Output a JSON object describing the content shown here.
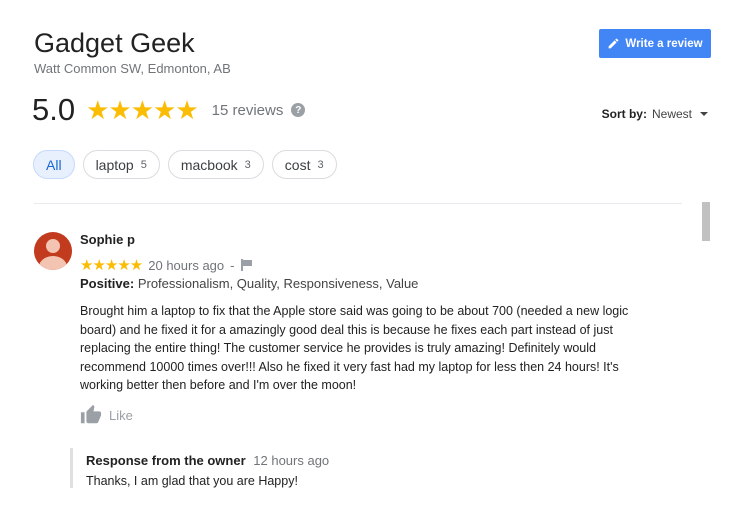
{
  "business": {
    "name": "Gadget Geek",
    "address": "Watt Common SW, Edmonton, AB",
    "write_review_label": "Write a review",
    "rating": "5.0",
    "stars": "★★★★★",
    "reviews_count": "15 reviews",
    "help_icon": "?"
  },
  "sort": {
    "label": "Sort by:",
    "value": "Newest"
  },
  "filters": [
    {
      "label": "All",
      "count": ""
    },
    {
      "label": "laptop",
      "count": "5"
    },
    {
      "label": "macbook",
      "count": "3"
    },
    {
      "label": "cost",
      "count": "3"
    }
  ],
  "review": {
    "author": "Sophie p",
    "stars": "★★★★★",
    "time": "20 hours ago",
    "separator": "-",
    "positive_label": "Positive:",
    "positive_values": "Professionalism, Quality, Responsiveness, Value",
    "text": "Brought him a laptop to fix that the Apple store said was going to be about 700 (needed a new logic board) and he fixed it for a amazingly good deal this is because he fixes each part instead of just replacing the entire thing! The customer service he provides is truly amazing! Definitely would recommend 10000 times over!!! Also he fixed it very fast had my laptop for less then 24 hours! It's working better then before and I'm over the moon!",
    "like_label": "Like"
  },
  "owner_response": {
    "title": "Response from the owner",
    "time": "12 hours ago",
    "text": "Thanks, I am glad that you are Happy!"
  },
  "colors": {
    "accent": "#4285f4",
    "star": "#fbbc04",
    "avatar": "#c23b1e"
  }
}
